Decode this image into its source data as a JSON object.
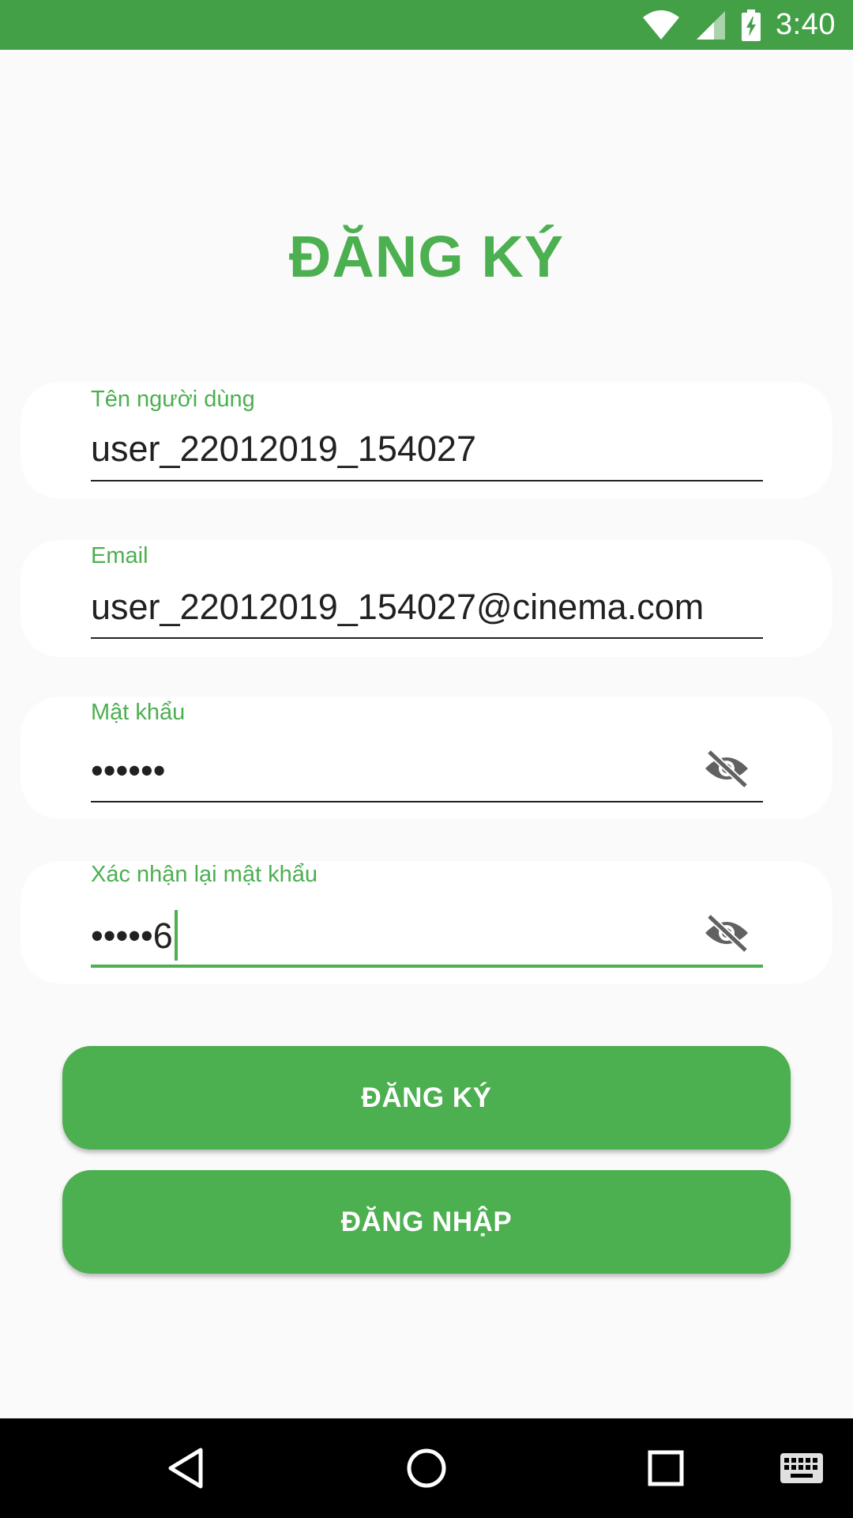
{
  "status_bar": {
    "time": "3:40",
    "icons": [
      "wifi-icon",
      "cell-signal-icon",
      "battery-charging-icon"
    ]
  },
  "title": "ĐĂNG KÝ",
  "form": {
    "username": {
      "label": "Tên người dùng",
      "value": "user_22012019_154027"
    },
    "email": {
      "label": "Email",
      "value": "user_22012019_154027@cinema.com"
    },
    "password": {
      "label": "Mật khẩu",
      "value": "••••••",
      "toggle_icon": "eye-off-icon"
    },
    "confirm_password": {
      "label": "Xác nhận lại mật khẩu",
      "value": "•••••6",
      "toggle_icon": "eye-off-icon"
    }
  },
  "buttons": {
    "register": "ĐĂNG KÝ",
    "login": "ĐĂNG NHẬP"
  },
  "nav_bar": {
    "icons": [
      "back-icon",
      "home-icon",
      "recents-icon",
      "keyboard-icon"
    ]
  },
  "colors": {
    "accent": "#4caf50",
    "status_bar": "#43a047",
    "background": "#fafafa"
  }
}
